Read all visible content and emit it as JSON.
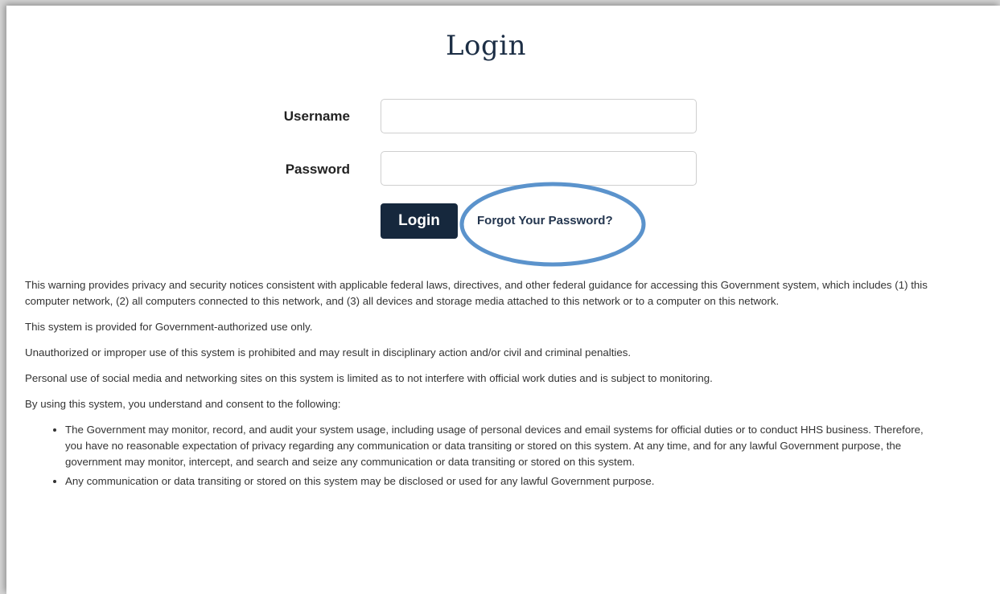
{
  "page": {
    "title": "Login"
  },
  "form": {
    "username_label": "Username",
    "password_label": "Password",
    "username_value": "",
    "password_value": "",
    "login_button": "Login",
    "forgot_link": "Forgot Your Password?"
  },
  "notice": {
    "paragraphs": [
      "This warning provides privacy and security notices consistent with applicable federal laws, directives, and other federal guidance for accessing this Government system, which includes (1) this computer network, (2) all computers connected to this network, and (3) all devices and storage media attached to this network or to a computer on this network.",
      "This system is provided for Government-authorized use only.",
      "Unauthorized or improper use of this system is prohibited and may result in disciplinary action and/or civil and criminal penalties.",
      "Personal use of social media and networking sites on this system is limited as to not interfere with official work duties and is subject to monitoring.",
      "By using this system, you understand and consent to the following:"
    ],
    "bullets": [
      "The Government may monitor, record, and audit your system usage, including usage of personal devices and email systems for official duties or to conduct HHS business. Therefore, you have no reasonable expectation of privacy regarding any communication or data transiting or stored on this system. At any time, and for any lawful Government purpose, the government may monitor, intercept, and search and seize any communication or data transiting or stored on this system.",
      "Any communication or data transiting or stored on this system may be disclosed or used for any lawful Government purpose."
    ]
  },
  "colors": {
    "button_bg": "#16283d",
    "title": "#1c2e45",
    "highlight": "#5b93cc"
  }
}
